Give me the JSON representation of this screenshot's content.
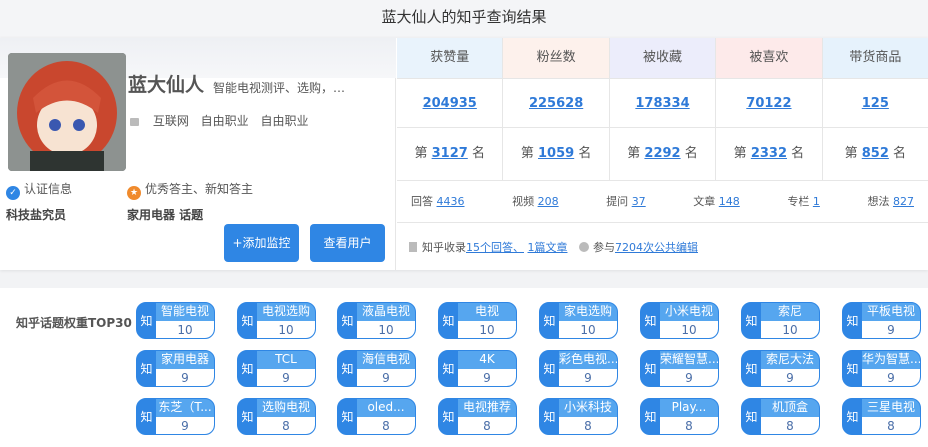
{
  "title": "蓝大仙人的知乎查询结果",
  "profile": {
    "name": "蓝大仙人",
    "headline": "智能电视测评、选购，…",
    "job": [
      "互联网",
      "自由职业",
      "自由职业"
    ],
    "cert_label": "认证信息",
    "cert_value": "科技盐究员",
    "honor_label": "优秀答主、新知答主",
    "honor_value": "家用电器 话题",
    "add_monitor": "+添加监控",
    "view_user": "查看用户"
  },
  "stats": {
    "headers": [
      "获赞量",
      "粉丝数",
      "被收藏",
      "被喜欢",
      "带货商品"
    ],
    "header_colors": [
      "#e9f3fc",
      "#fdf1ec",
      "#ecedfb",
      "#fdeaea",
      "#e6f2fc"
    ],
    "values": [
      "204935",
      "225628",
      "178334",
      "70122",
      "125"
    ],
    "rank_prefix": "第",
    "rank_suffix": "名",
    "ranks": [
      "3127",
      "1059",
      "2292",
      "2332",
      "852"
    ]
  },
  "counts": [
    {
      "label": "回答",
      "value": "4436"
    },
    {
      "label": "视频",
      "value": "208"
    },
    {
      "label": "提问",
      "value": "37"
    },
    {
      "label": "文章",
      "value": "148"
    },
    {
      "label": "专栏",
      "value": "1"
    },
    {
      "label": "想法",
      "value": "827"
    }
  ],
  "footer": {
    "collect_label": "知乎收录",
    "answers": "15个回答、",
    "articles": "1篇文章",
    "edit_label": "参与",
    "edits": "7204次公共编辑"
  },
  "topics": {
    "label": "知乎话题权重TOP30",
    "badge": "知",
    "items": [
      {
        "name": "智能电视",
        "w": "10"
      },
      {
        "name": "电视选购",
        "w": "10"
      },
      {
        "name": "液晶电视",
        "w": "10"
      },
      {
        "name": "电视",
        "w": "10"
      },
      {
        "name": "家电选购",
        "w": "10"
      },
      {
        "name": "小米电视",
        "w": "10"
      },
      {
        "name": "索尼",
        "w": "10"
      },
      {
        "name": "平板电视",
        "w": "9"
      },
      {
        "name": "家用电器",
        "w": "9"
      },
      {
        "name": "TCL",
        "w": "9"
      },
      {
        "name": "海信电视",
        "w": "9"
      },
      {
        "name": "4K",
        "w": "9"
      },
      {
        "name": "彩色电视...",
        "w": "9"
      },
      {
        "name": "荣耀智慧...",
        "w": "9"
      },
      {
        "name": "索尼大法",
        "w": "9"
      },
      {
        "name": "华为智慧...",
        "w": "9"
      },
      {
        "name": "东芝（T...",
        "w": "9"
      },
      {
        "name": "选购电视",
        "w": "8"
      },
      {
        "name": "oled...",
        "w": "8"
      },
      {
        "name": "电视推荐",
        "w": "8"
      },
      {
        "name": "小米科技",
        "w": "8"
      },
      {
        "name": "Play...",
        "w": "8"
      },
      {
        "name": "机顶盒",
        "w": "8"
      },
      {
        "name": "三星电视",
        "w": "8"
      }
    ]
  }
}
